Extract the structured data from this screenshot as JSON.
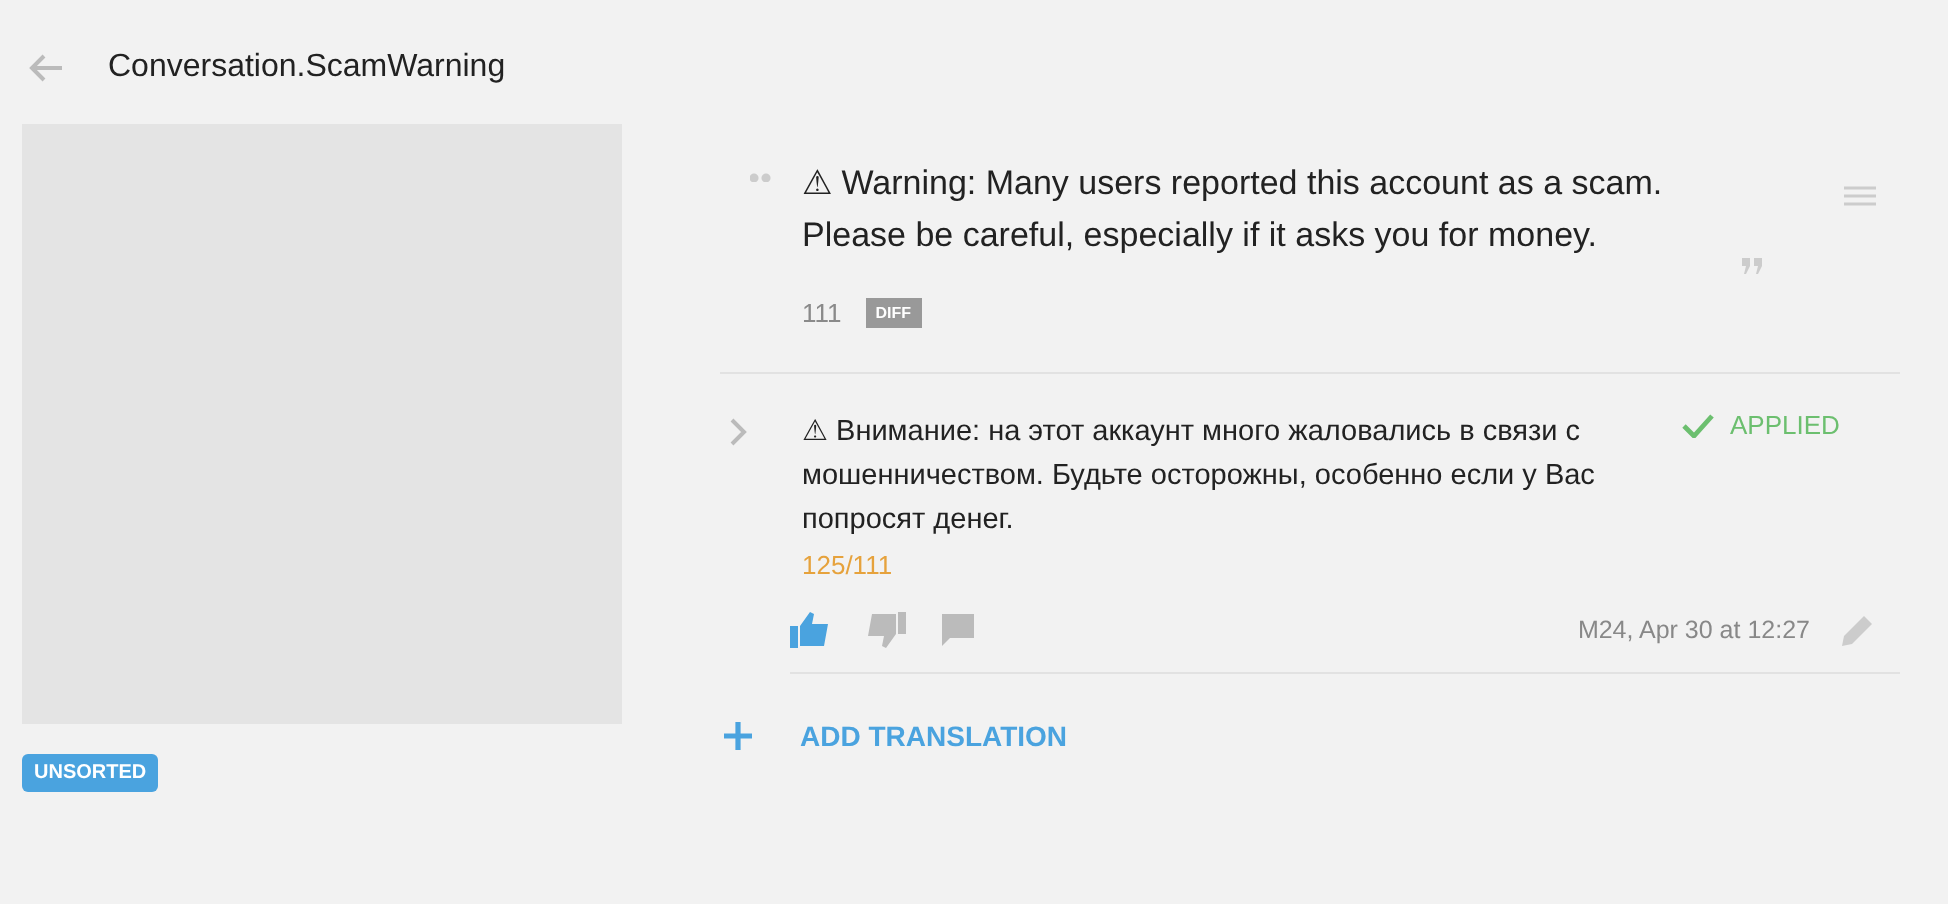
{
  "header": {
    "title": "Conversation.ScamWarning"
  },
  "sidebar": {
    "tag": "UNSORTED"
  },
  "source": {
    "text": "⚠ Warning: Many users reported this account as a scam. Please be careful, especially if it asks you for money.",
    "length": "111",
    "diff_label": "DIFF"
  },
  "translations": [
    {
      "text": "⚠ Внимание: на этот аккаунт много жаловались в связи с мошенничеством. Будьте осторожны, особенно если у Вас попросят денег.",
      "length": "125/111",
      "status": "APPLIED",
      "applied": true,
      "liked": true,
      "author_time": "M24, Apr 30 at 12:27"
    }
  ],
  "add_translation": "ADD TRANSLATION"
}
